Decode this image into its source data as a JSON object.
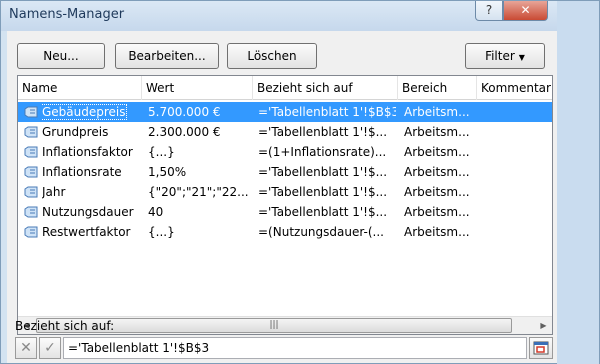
{
  "window": {
    "title": "Namens-Manager",
    "help_label": "?",
    "close_label": "✕"
  },
  "toolbar": {
    "new_label": "Neu...",
    "edit_label": "Bearbeiten...",
    "delete_label": "Löschen",
    "filter_label": "Filter",
    "filter_arrow": "▼"
  },
  "list": {
    "columns": [
      "Name",
      "Wert",
      "Bezieht sich auf",
      "Bereich",
      "Kommentar"
    ],
    "rows": [
      {
        "name": "Gebäudepreis",
        "wert": "5.700.000 €",
        "bezug": "='Tabellenblatt 1'!$B$3",
        "bereich": "Arbeitsm..."
      },
      {
        "name": "Grundpreis",
        "wert": "2.300.000 €",
        "bezug": "='Tabellenblatt 1'!$...",
        "bereich": "Arbeitsm..."
      },
      {
        "name": "Inflationsfaktor",
        "wert": "{...}",
        "bezug": "=(1+Inflationsrate)...",
        "bereich": "Arbeitsm..."
      },
      {
        "name": "Inflationsrate",
        "wert": "1,50%",
        "bezug": "='Tabellenblatt 1'!$...",
        "bereich": "Arbeitsm..."
      },
      {
        "name": "Jahr",
        "wert": "{\"20\";\"21\";\"22...",
        "bezug": "='Tabellenblatt 1'!$...",
        "bereich": "Arbeitsm..."
      },
      {
        "name": "Nutzungsdauer",
        "wert": "40",
        "bezug": "='Tabellenblatt 1'!$...",
        "bereich": "Arbeitsm..."
      },
      {
        "name": "Restwertfaktor",
        "wert": "{...}",
        "bezug": "=(Nutzungsdauer-(...",
        "bereich": "Arbeitsm..."
      }
    ],
    "selected_row": 0,
    "scroll_left": "◀",
    "scroll_right": "▶",
    "scroll_grip": "|||"
  },
  "reference": {
    "label": "Bezieht sich auf:",
    "value": "='Tabellenblatt 1'!$B$3",
    "cancel_glyph": "✕",
    "ok_glyph": "✓"
  },
  "colors": {
    "selection": "#3399ff",
    "dialog_bg": "#f0f0f0",
    "frame": "#d3e3f1"
  }
}
